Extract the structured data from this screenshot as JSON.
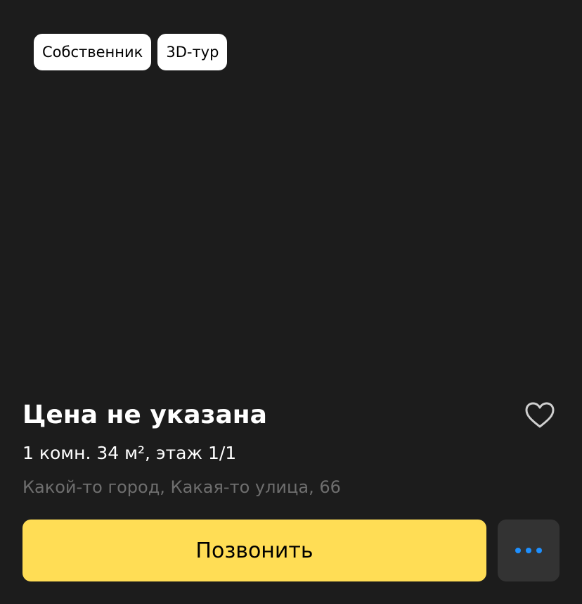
{
  "badges": {
    "owner": "Собственник",
    "tour": "3D-тур"
  },
  "listing": {
    "price": "Цена не указана",
    "details": "1 комн. 34 м², этаж 1/1",
    "address": "Какой-то город, Какая-то улица, 66"
  },
  "actions": {
    "call_label": "Позвонить",
    "favorite_icon": "heart-outline-icon",
    "more_icon": "more-dots-icon"
  },
  "colors": {
    "background": "#1c1c1c",
    "accent": "#ffdd55",
    "more_dots": "#1e90ff",
    "secondary_text": "#6e6e6e"
  }
}
